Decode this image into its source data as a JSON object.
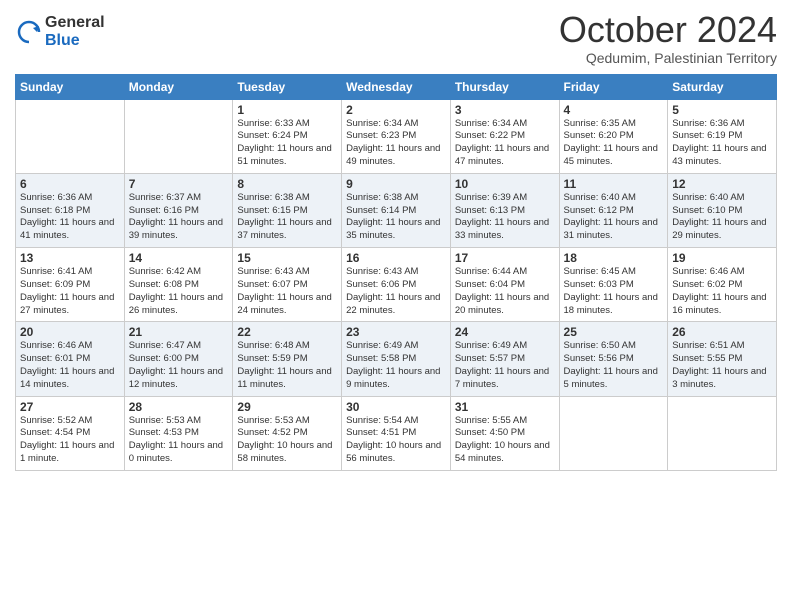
{
  "logo": {
    "general": "General",
    "blue": "Blue"
  },
  "title": "October 2024",
  "subtitle": "Qedumim, Palestinian Territory",
  "days_of_week": [
    "Sunday",
    "Monday",
    "Tuesday",
    "Wednesday",
    "Thursday",
    "Friday",
    "Saturday"
  ],
  "weeks": [
    [
      {
        "num": "",
        "info": ""
      },
      {
        "num": "",
        "info": ""
      },
      {
        "num": "1",
        "info": "Sunrise: 6:33 AM\nSunset: 6:24 PM\nDaylight: 11 hours and 51 minutes."
      },
      {
        "num": "2",
        "info": "Sunrise: 6:34 AM\nSunset: 6:23 PM\nDaylight: 11 hours and 49 minutes."
      },
      {
        "num": "3",
        "info": "Sunrise: 6:34 AM\nSunset: 6:22 PM\nDaylight: 11 hours and 47 minutes."
      },
      {
        "num": "4",
        "info": "Sunrise: 6:35 AM\nSunset: 6:20 PM\nDaylight: 11 hours and 45 minutes."
      },
      {
        "num": "5",
        "info": "Sunrise: 6:36 AM\nSunset: 6:19 PM\nDaylight: 11 hours and 43 minutes."
      }
    ],
    [
      {
        "num": "6",
        "info": "Sunrise: 6:36 AM\nSunset: 6:18 PM\nDaylight: 11 hours and 41 minutes."
      },
      {
        "num": "7",
        "info": "Sunrise: 6:37 AM\nSunset: 6:16 PM\nDaylight: 11 hours and 39 minutes."
      },
      {
        "num": "8",
        "info": "Sunrise: 6:38 AM\nSunset: 6:15 PM\nDaylight: 11 hours and 37 minutes."
      },
      {
        "num": "9",
        "info": "Sunrise: 6:38 AM\nSunset: 6:14 PM\nDaylight: 11 hours and 35 minutes."
      },
      {
        "num": "10",
        "info": "Sunrise: 6:39 AM\nSunset: 6:13 PM\nDaylight: 11 hours and 33 minutes."
      },
      {
        "num": "11",
        "info": "Sunrise: 6:40 AM\nSunset: 6:12 PM\nDaylight: 11 hours and 31 minutes."
      },
      {
        "num": "12",
        "info": "Sunrise: 6:40 AM\nSunset: 6:10 PM\nDaylight: 11 hours and 29 minutes."
      }
    ],
    [
      {
        "num": "13",
        "info": "Sunrise: 6:41 AM\nSunset: 6:09 PM\nDaylight: 11 hours and 27 minutes."
      },
      {
        "num": "14",
        "info": "Sunrise: 6:42 AM\nSunset: 6:08 PM\nDaylight: 11 hours and 26 minutes."
      },
      {
        "num": "15",
        "info": "Sunrise: 6:43 AM\nSunset: 6:07 PM\nDaylight: 11 hours and 24 minutes."
      },
      {
        "num": "16",
        "info": "Sunrise: 6:43 AM\nSunset: 6:06 PM\nDaylight: 11 hours and 22 minutes."
      },
      {
        "num": "17",
        "info": "Sunrise: 6:44 AM\nSunset: 6:04 PM\nDaylight: 11 hours and 20 minutes."
      },
      {
        "num": "18",
        "info": "Sunrise: 6:45 AM\nSunset: 6:03 PM\nDaylight: 11 hours and 18 minutes."
      },
      {
        "num": "19",
        "info": "Sunrise: 6:46 AM\nSunset: 6:02 PM\nDaylight: 11 hours and 16 minutes."
      }
    ],
    [
      {
        "num": "20",
        "info": "Sunrise: 6:46 AM\nSunset: 6:01 PM\nDaylight: 11 hours and 14 minutes."
      },
      {
        "num": "21",
        "info": "Sunrise: 6:47 AM\nSunset: 6:00 PM\nDaylight: 11 hours and 12 minutes."
      },
      {
        "num": "22",
        "info": "Sunrise: 6:48 AM\nSunset: 5:59 PM\nDaylight: 11 hours and 11 minutes."
      },
      {
        "num": "23",
        "info": "Sunrise: 6:49 AM\nSunset: 5:58 PM\nDaylight: 11 hours and 9 minutes."
      },
      {
        "num": "24",
        "info": "Sunrise: 6:49 AM\nSunset: 5:57 PM\nDaylight: 11 hours and 7 minutes."
      },
      {
        "num": "25",
        "info": "Sunrise: 6:50 AM\nSunset: 5:56 PM\nDaylight: 11 hours and 5 minutes."
      },
      {
        "num": "26",
        "info": "Sunrise: 6:51 AM\nSunset: 5:55 PM\nDaylight: 11 hours and 3 minutes."
      }
    ],
    [
      {
        "num": "27",
        "info": "Sunrise: 5:52 AM\nSunset: 4:54 PM\nDaylight: 11 hours and 1 minute."
      },
      {
        "num": "28",
        "info": "Sunrise: 5:53 AM\nSunset: 4:53 PM\nDaylight: 11 hours and 0 minutes."
      },
      {
        "num": "29",
        "info": "Sunrise: 5:53 AM\nSunset: 4:52 PM\nDaylight: 10 hours and 58 minutes."
      },
      {
        "num": "30",
        "info": "Sunrise: 5:54 AM\nSunset: 4:51 PM\nDaylight: 10 hours and 56 minutes."
      },
      {
        "num": "31",
        "info": "Sunrise: 5:55 AM\nSunset: 4:50 PM\nDaylight: 10 hours and 54 minutes."
      },
      {
        "num": "",
        "info": ""
      },
      {
        "num": "",
        "info": ""
      }
    ]
  ]
}
